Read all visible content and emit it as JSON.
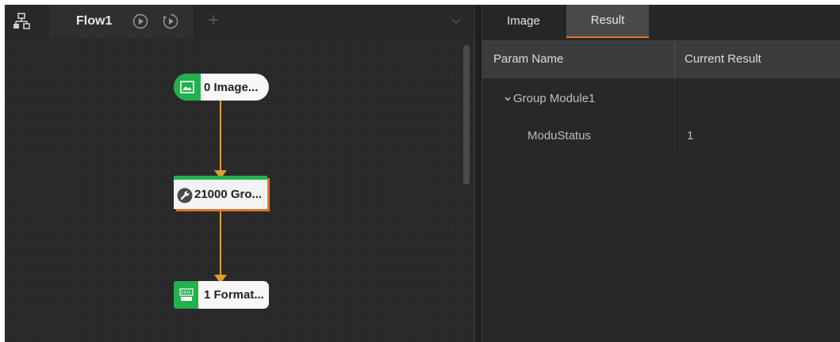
{
  "flow_panel": {
    "tab_title": "Flow1",
    "add_tab_glyph": "+",
    "icons": {
      "tree": "flow-tree-icon",
      "run_once": "run-once-icon",
      "run_loop": "run-loop-icon",
      "dropdown": "chevron-down-icon"
    },
    "nodes": [
      {
        "label": "0 Image...",
        "icon": "image-icon"
      },
      {
        "label": "21000 Gro...",
        "icon": "wrench-icon"
      },
      {
        "label": "1 Format...",
        "icon": "format-str-icon"
      }
    ],
    "colors": {
      "node_status": "#22b14c",
      "connector": "#e0a12d",
      "group_shadow": "#e0742d"
    }
  },
  "result_panel": {
    "tabs": [
      {
        "label": "Image",
        "active": false
      },
      {
        "label": "Result",
        "active": true
      }
    ],
    "columns": {
      "name": "Param Name",
      "result": "Current Result"
    },
    "rows": [
      {
        "name": "Group Module1",
        "value": "",
        "expanded": true
      },
      {
        "name": "ModuStatus",
        "value": "1"
      }
    ]
  }
}
